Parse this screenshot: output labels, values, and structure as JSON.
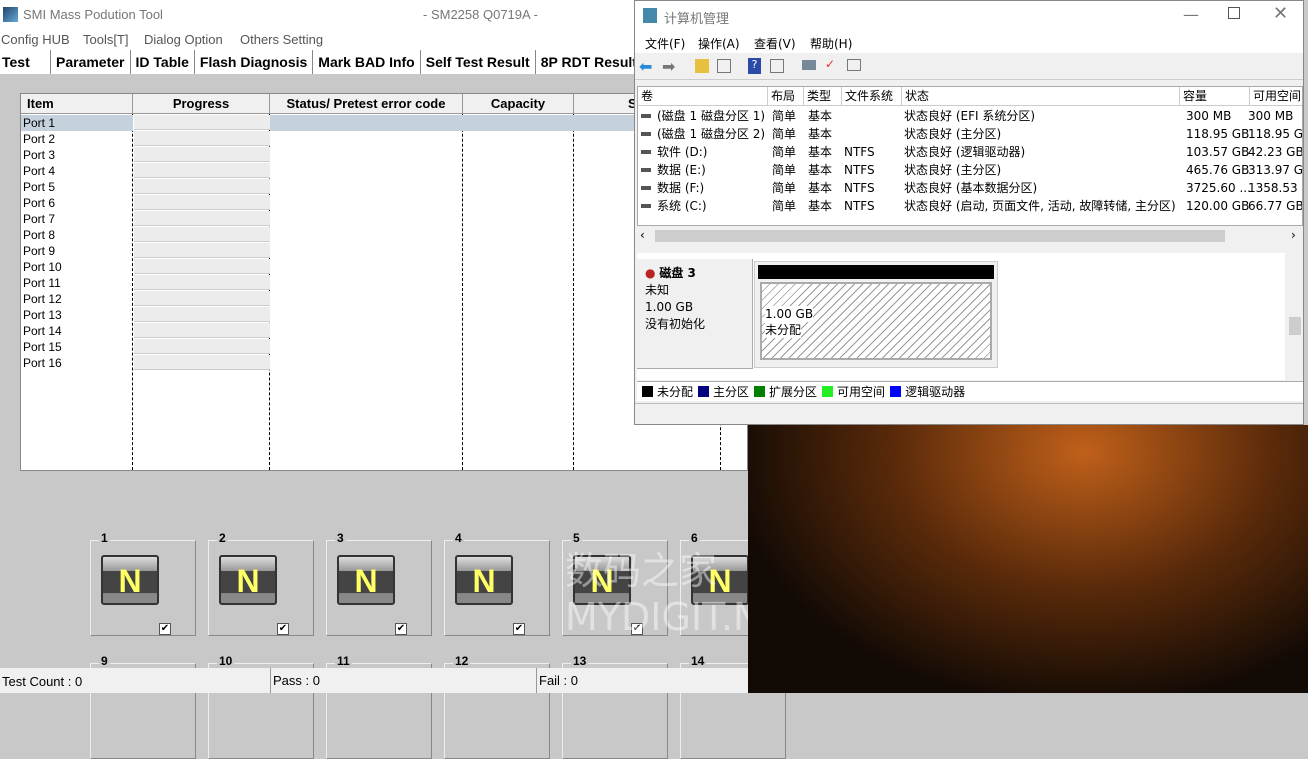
{
  "smi": {
    "title": "SMI Mass Podution Tool",
    "subtitle": "- SM2258 Q0719A -",
    "menu": [
      "Config HUB",
      "Tools[T]",
      "Dialog Option",
      "Others Setting"
    ],
    "tabs": [
      "Test",
      "Parameter",
      "ID Table",
      "Flash Diagnosis",
      "Mark BAD Info",
      "Self Test Result",
      "8P RDT Result"
    ],
    "columns": [
      "Item",
      "Progress",
      "Status/ Pretest error code",
      "Capacity",
      "S"
    ],
    "ports": [
      "Port 1",
      "Port 2",
      "Port 3",
      "Port 4",
      "Port 5",
      "Port 6",
      "Port 7",
      "Port 8",
      "Port 9",
      "Port 10",
      "Port 11",
      "Port 12",
      "Port 13",
      "Port 14",
      "Port 15",
      "Port 16"
    ],
    "slots_row1": [
      "1",
      "2",
      "3",
      "4",
      "5",
      "6"
    ],
    "slots_row2": [
      "9",
      "10",
      "11",
      "12",
      "13",
      "14"
    ],
    "drive_letter": "N",
    "status": {
      "test_count": "Test Count : 0",
      "pass": "Pass : 0",
      "fail": "Fail : 0"
    }
  },
  "cm": {
    "title": "计算机管理",
    "menu": [
      "文件(F)",
      "操作(A)",
      "查看(V)",
      "帮助(H)"
    ],
    "columns": [
      "卷",
      "布局",
      "类型",
      "文件系统",
      "状态",
      "容量",
      "可用空间"
    ],
    "rows": [
      [
        "(磁盘 1 磁盘分区 1)",
        "简单",
        "基本",
        "",
        "状态良好 (EFI 系统分区)",
        "300 MB",
        "300 MB"
      ],
      [
        "(磁盘 1 磁盘分区 2)",
        "简单",
        "基本",
        "",
        "状态良好 (主分区)",
        "118.95 GB",
        "118.95 G"
      ],
      [
        "软件 (D:)",
        "简单",
        "基本",
        "NTFS",
        "状态良好 (逻辑驱动器)",
        "103.57 GB",
        "42.23 GB"
      ],
      [
        "数据 (E:)",
        "简单",
        "基本",
        "NTFS",
        "状态良好 (主分区)",
        "465.76 GB",
        "313.97 G"
      ],
      [
        "数据 (F:)",
        "简单",
        "基本",
        "NTFS",
        "状态良好 (基本数据分区)",
        "3725.60 ...",
        "1358.53"
      ],
      [
        "系统 (C:)",
        "简单",
        "基本",
        "NTFS",
        "状态良好 (启动, 页面文件, 活动, 故障转储, 主分区)",
        "120.00 GB",
        "66.77 GB"
      ]
    ],
    "disk": {
      "name": "磁盘 3",
      "type": "未知",
      "size": "1.00 GB",
      "state": "没有初始化",
      "part_size": "1.00 GB",
      "part_label": "未分配"
    },
    "legend": [
      {
        "label": "未分配",
        "color": "#000000"
      },
      {
        "label": "主分区",
        "color": "#000080"
      },
      {
        "label": "扩展分区",
        "color": "#008000"
      },
      {
        "label": "可用空间",
        "color": "#22ee22"
      },
      {
        "label": "逻辑驱动器",
        "color": "#0000ff"
      }
    ]
  },
  "watermark": "数码之家 MYDIGIT.NET"
}
